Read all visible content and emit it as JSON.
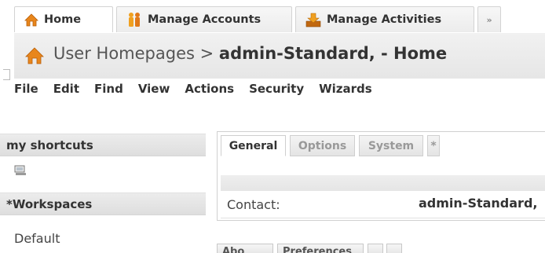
{
  "top_tabs": [
    {
      "label": "Home",
      "icon": "home-icon",
      "active": true
    },
    {
      "label": "Manage Accounts",
      "icon": "accounts-icon",
      "active": false
    },
    {
      "label": "Manage Activities",
      "icon": "activities-icon",
      "active": false
    },
    {
      "label": "»",
      "icon": "",
      "active": false
    }
  ],
  "breadcrumb": {
    "prefix": "User Homepages > ",
    "current": "admin-Standard, - Home",
    "icon": "home-icon"
  },
  "menu": [
    "File",
    "Edit",
    "Find",
    "View",
    "Actions",
    "Security",
    "Wizards"
  ],
  "sidebar": {
    "shortcuts_header": "my shortcuts",
    "shortcut_icon": "computer-icon",
    "workspaces_header": "*Workspaces",
    "workspace_item": "Default"
  },
  "panel": {
    "tabs": [
      "General",
      "Options",
      "System",
      "*"
    ],
    "contact_label": "Contact:",
    "contact_value": "admin-Standard,"
  },
  "bottom_buttons": [
    "Abo",
    "Preferences",
    "",
    ""
  ],
  "colors": {
    "home_icon": "#e8861c",
    "accent_orange": "#f0a020"
  }
}
